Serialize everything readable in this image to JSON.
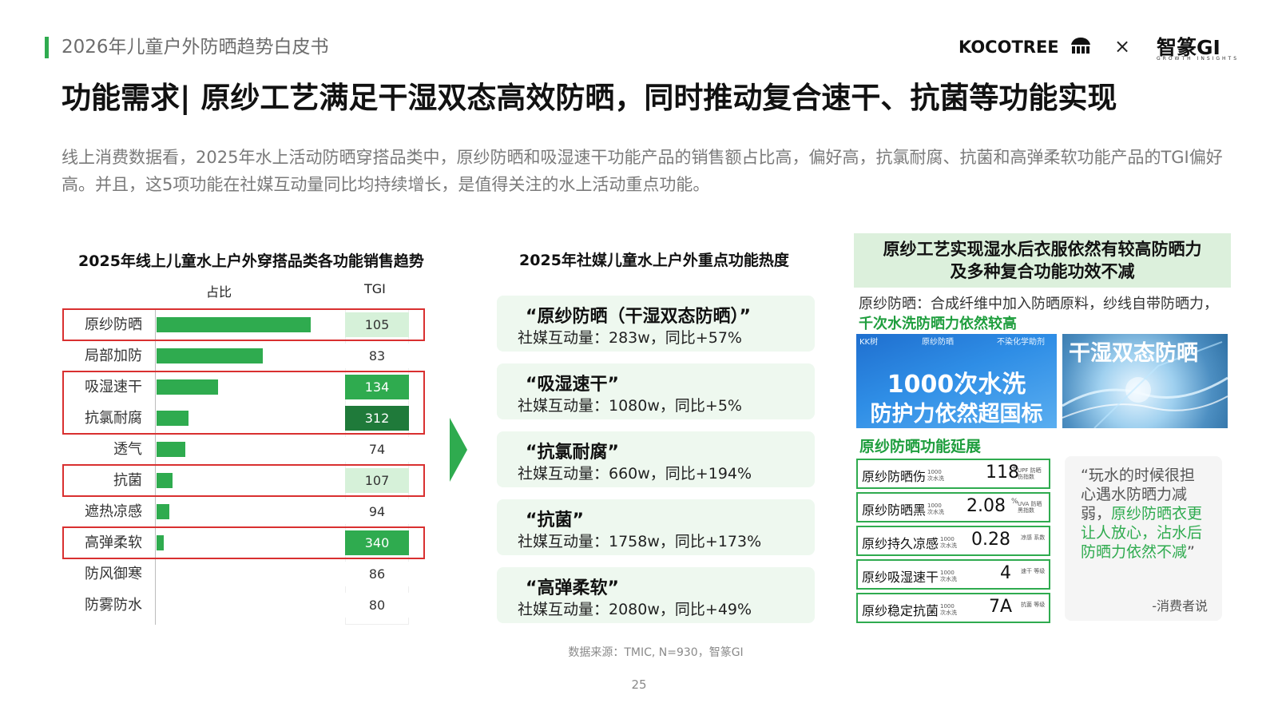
{
  "header": {
    "report_title": "2026年儿童户外防晒趋势白皮书",
    "logo_left": "KOCOTREE",
    "logo_separator": "×",
    "logo_right": "智篆GI",
    "logo_right_tagline": "GROWTH INSIGHTS",
    "main_title": "功能需求| 原纱工艺满足干湿双态高效防晒，同时推动复合速干、抗菌等功能实现",
    "subtitle": "线上消费数据看，2025年水上活动防晒穿搭品类中，原纱防晒和吸湿速干功能产品的销售额占比高，偏好高，抗氯耐腐、抗菌和高弹柔软功能产品的TGI偏好高。并且，这5项功能在社媒互动量同比均持续增长，是值得关注的水上活动重点功能。"
  },
  "chart_data": {
    "type": "bar",
    "title": "2025年线上儿童水上户外穿搭品类各功能销售趋势",
    "column_headers": [
      "占比",
      "TGI"
    ],
    "categories": [
      "原纱防晒",
      "局部加防",
      "吸湿速干",
      "抗氯耐腐",
      "透气",
      "抗菌",
      "遮热凉感",
      "高弹柔软",
      "防风御寒",
      "防雾防水"
    ],
    "series": [
      {
        "name": "占比",
        "values": [
          0.29,
          0.2,
          0.115,
          0.06,
          0.054,
          0.03,
          0.024,
          0.014,
          0.0,
          0.0
        ]
      },
      {
        "name": "TGI",
        "values": [
          105,
          83,
          134,
          312,
          74,
          107,
          94,
          340,
          86,
          80
        ]
      }
    ],
    "tgi_fill_colors": [
      "#d6f1d9",
      "#ffffff",
      "#2fab4f",
      "#1f7a3a",
      "#ffffff",
      "#d6f1d9",
      "#ffffff",
      "#2fab4f",
      "#ffffff",
      "#ffffff"
    ],
    "tgi_text_colors": [
      "#333333",
      "#333333",
      "#ffffff",
      "#ffffff",
      "#333333",
      "#333333",
      "#333333",
      "#ffffff",
      "#333333",
      "#333333"
    ],
    "highlight_groups": [
      [
        0
      ],
      [
        2,
        3
      ],
      [
        5
      ],
      [
        7
      ]
    ]
  },
  "middle": {
    "title": "2025年社媒儿童水上户外重点功能热度",
    "features": [
      {
        "name": "“原纱防晒（干湿双态防晒）”",
        "stat": "社媒互动量：283w，同比+57%"
      },
      {
        "name": "“吸湿速干”",
        "stat": "社媒互动量：1080w，同比+5%"
      },
      {
        "name": "“抗氯耐腐”",
        "stat": "社媒互动量：660w，同比+194%"
      },
      {
        "name": "“抗菌”",
        "stat": "社媒互动量：1758w，同比+173%"
      },
      {
        "name": "“高弹柔软”",
        "stat": "社媒互动量：2080w，同比+49%"
      }
    ],
    "source": "数据来源：TMIC, N=930，智篆GI"
  },
  "right": {
    "header_line1": "原纱工艺实现湿水后衣服依然有较高防晒力",
    "header_line2": "及多种复合功能功效不减",
    "desc_plain": "原纱防晒：合成纤维中加入防晒原料，纱线自带防晒力，",
    "desc_highlight": "千次水洗防晒力依然较高",
    "image1": {
      "brand": "KK树",
      "tag_mid": "原纱防晒",
      "tag_right": "不染化学助剂",
      "headline": "1000次水洗",
      "subline": "防护力依然超国标"
    },
    "image2": {
      "text": "干湿双态防晒"
    },
    "extension_title": "原纱防晒功能延展",
    "specs": [
      {
        "name": "原纱防晒伤",
        "note": "1000次水洗",
        "value": "118",
        "sup": "+",
        "unit": "UPF 防晒伤指数"
      },
      {
        "name": "原纱防晒黑",
        "note": "1000次水洗",
        "value": "2.08",
        "sup": "%",
        "unit": "UVA 防晒黑指数"
      },
      {
        "name": "原纱持久凉感",
        "note": "1000次水洗",
        "value": "0.28",
        "sup": "",
        "unit": "凉感 系数"
      },
      {
        "name": "原纱吸湿速干",
        "note": "1000次水洗",
        "value": "4",
        "sup": "",
        "unit": "速干 等级"
      },
      {
        "name": "原纱稳定抗菌",
        "note": "1000次水洗",
        "value": "7A",
        "sup": "",
        "unit": "抗菌 等级"
      }
    ],
    "quote": {
      "before": "“玩水的时候很担心遇水防晒力减弱，",
      "highlight": "原纱防晒衣更让人放心，沾水后防晒力依然不减",
      "after": "”",
      "by": "-消费者说"
    }
  },
  "page_number": "25",
  "colors": {
    "accent": "#2fab4f",
    "accent_dark": "#1f7a3a",
    "highlight_border": "#d93030",
    "card_bg": "#eef8ef"
  }
}
